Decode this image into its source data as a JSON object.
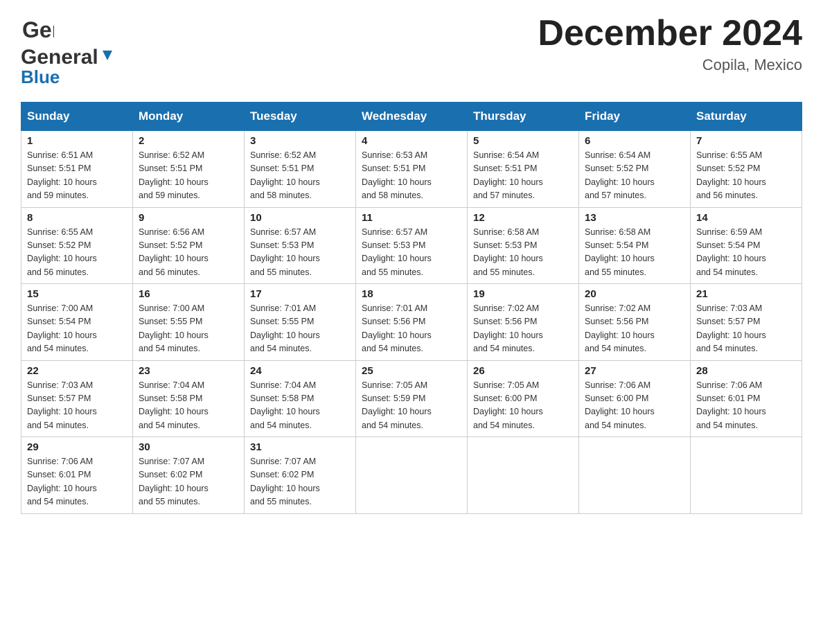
{
  "header": {
    "logo_general": "General",
    "logo_blue": "Blue",
    "title": "December 2024",
    "subtitle": "Copila, Mexico"
  },
  "calendar": {
    "days_of_week": [
      "Sunday",
      "Monday",
      "Tuesday",
      "Wednesday",
      "Thursday",
      "Friday",
      "Saturday"
    ],
    "weeks": [
      [
        {
          "day": "1",
          "sunrise": "6:51 AM",
          "sunset": "5:51 PM",
          "daylight": "10 hours and 59 minutes."
        },
        {
          "day": "2",
          "sunrise": "6:52 AM",
          "sunset": "5:51 PM",
          "daylight": "10 hours and 59 minutes."
        },
        {
          "day": "3",
          "sunrise": "6:52 AM",
          "sunset": "5:51 PM",
          "daylight": "10 hours and 58 minutes."
        },
        {
          "day": "4",
          "sunrise": "6:53 AM",
          "sunset": "5:51 PM",
          "daylight": "10 hours and 58 minutes."
        },
        {
          "day": "5",
          "sunrise": "6:54 AM",
          "sunset": "5:51 PM",
          "daylight": "10 hours and 57 minutes."
        },
        {
          "day": "6",
          "sunrise": "6:54 AM",
          "sunset": "5:52 PM",
          "daylight": "10 hours and 57 minutes."
        },
        {
          "day": "7",
          "sunrise": "6:55 AM",
          "sunset": "5:52 PM",
          "daylight": "10 hours and 56 minutes."
        }
      ],
      [
        {
          "day": "8",
          "sunrise": "6:55 AM",
          "sunset": "5:52 PM",
          "daylight": "10 hours and 56 minutes."
        },
        {
          "day": "9",
          "sunrise": "6:56 AM",
          "sunset": "5:52 PM",
          "daylight": "10 hours and 56 minutes."
        },
        {
          "day": "10",
          "sunrise": "6:57 AM",
          "sunset": "5:53 PM",
          "daylight": "10 hours and 55 minutes."
        },
        {
          "day": "11",
          "sunrise": "6:57 AM",
          "sunset": "5:53 PM",
          "daylight": "10 hours and 55 minutes."
        },
        {
          "day": "12",
          "sunrise": "6:58 AM",
          "sunset": "5:53 PM",
          "daylight": "10 hours and 55 minutes."
        },
        {
          "day": "13",
          "sunrise": "6:58 AM",
          "sunset": "5:54 PM",
          "daylight": "10 hours and 55 minutes."
        },
        {
          "day": "14",
          "sunrise": "6:59 AM",
          "sunset": "5:54 PM",
          "daylight": "10 hours and 54 minutes."
        }
      ],
      [
        {
          "day": "15",
          "sunrise": "7:00 AM",
          "sunset": "5:54 PM",
          "daylight": "10 hours and 54 minutes."
        },
        {
          "day": "16",
          "sunrise": "7:00 AM",
          "sunset": "5:55 PM",
          "daylight": "10 hours and 54 minutes."
        },
        {
          "day": "17",
          "sunrise": "7:01 AM",
          "sunset": "5:55 PM",
          "daylight": "10 hours and 54 minutes."
        },
        {
          "day": "18",
          "sunrise": "7:01 AM",
          "sunset": "5:56 PM",
          "daylight": "10 hours and 54 minutes."
        },
        {
          "day": "19",
          "sunrise": "7:02 AM",
          "sunset": "5:56 PM",
          "daylight": "10 hours and 54 minutes."
        },
        {
          "day": "20",
          "sunrise": "7:02 AM",
          "sunset": "5:56 PM",
          "daylight": "10 hours and 54 minutes."
        },
        {
          "day": "21",
          "sunrise": "7:03 AM",
          "sunset": "5:57 PM",
          "daylight": "10 hours and 54 minutes."
        }
      ],
      [
        {
          "day": "22",
          "sunrise": "7:03 AM",
          "sunset": "5:57 PM",
          "daylight": "10 hours and 54 minutes."
        },
        {
          "day": "23",
          "sunrise": "7:04 AM",
          "sunset": "5:58 PM",
          "daylight": "10 hours and 54 minutes."
        },
        {
          "day": "24",
          "sunrise": "7:04 AM",
          "sunset": "5:58 PM",
          "daylight": "10 hours and 54 minutes."
        },
        {
          "day": "25",
          "sunrise": "7:05 AM",
          "sunset": "5:59 PM",
          "daylight": "10 hours and 54 minutes."
        },
        {
          "day": "26",
          "sunrise": "7:05 AM",
          "sunset": "6:00 PM",
          "daylight": "10 hours and 54 minutes."
        },
        {
          "day": "27",
          "sunrise": "7:06 AM",
          "sunset": "6:00 PM",
          "daylight": "10 hours and 54 minutes."
        },
        {
          "day": "28",
          "sunrise": "7:06 AM",
          "sunset": "6:01 PM",
          "daylight": "10 hours and 54 minutes."
        }
      ],
      [
        {
          "day": "29",
          "sunrise": "7:06 AM",
          "sunset": "6:01 PM",
          "daylight": "10 hours and 54 minutes."
        },
        {
          "day": "30",
          "sunrise": "7:07 AM",
          "sunset": "6:02 PM",
          "daylight": "10 hours and 55 minutes."
        },
        {
          "day": "31",
          "sunrise": "7:07 AM",
          "sunset": "6:02 PM",
          "daylight": "10 hours and 55 minutes."
        },
        null,
        null,
        null,
        null
      ]
    ],
    "sunrise_label": "Sunrise:",
    "sunset_label": "Sunset:",
    "daylight_label": "Daylight:"
  }
}
